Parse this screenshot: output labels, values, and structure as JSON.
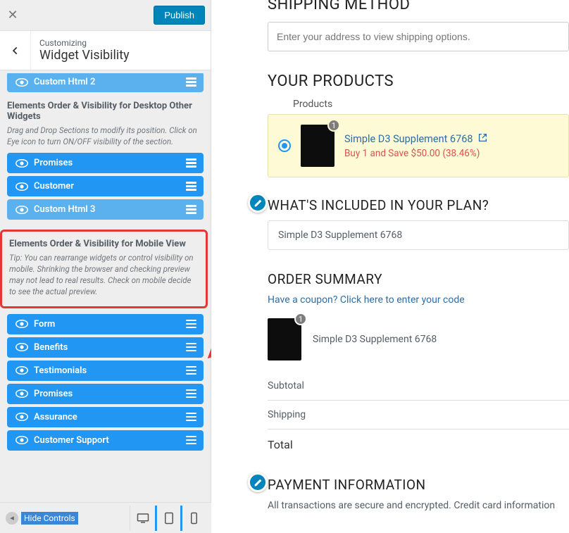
{
  "topbar": {
    "publish": "Publish"
  },
  "crumb": {
    "small": "Customizing",
    "title": "Widget Visibility"
  },
  "desktop": {
    "stray": "Custom Html 2",
    "title": "Elements Order & Visibility for Desktop Other Widgets",
    "tip": "Drag and Drop Sections to modify its position. Click on Eye icon to turn ON/OFF visibility of the section.",
    "items": [
      "Promises",
      "Customer",
      "Custom Html 3"
    ]
  },
  "mobile": {
    "title": "Elements Order & Visibility for Mobile View",
    "tip": "Tip: You can rearrange widgets or control visibility on mobile. Shrinking the browser and checking preview may not lead to real results. Check on mobile decide to see the actual preview.",
    "items": [
      "Form",
      "Benefits",
      "Testimonials",
      "Promises",
      "Assurance",
      "Customer Support"
    ]
  },
  "footer": {
    "hide": "Hide Controls"
  },
  "preview": {
    "shipping_title": "SHIPPING METHOD",
    "shipping_placeholder": "Enter your address to view shipping options.",
    "products_title": "YOUR PRODUCTS",
    "products_label": "Products",
    "product_name": "Simple D3 Supplement 6768",
    "product_deal": "Buy 1 and Save $50.00 (38.46%)",
    "product_badge": "1",
    "plan_title": "WHAT'S INCLUDED IN YOUR PLAN?",
    "plan_item": "Simple D3 Supplement 6768",
    "summary_title": "ORDER SUMMARY",
    "coupon": "Have a coupon? Click here to enter your code",
    "order_item": "Simple D3 Supplement 6768",
    "order_badge": "1",
    "subtotal": "Subtotal",
    "shipping": "Shipping",
    "total": "Total",
    "payment_title": "PAYMENT INFORMATION",
    "payment_sub": "All transactions are secure and encrypted. Credit card information"
  }
}
